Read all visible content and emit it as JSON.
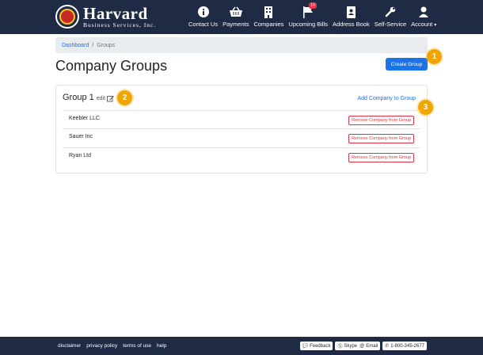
{
  "brand": {
    "name": "Harvard",
    "subtitle": "Business Services, Inc."
  },
  "nav": [
    {
      "label": "Contact Us",
      "icon": "info-icon"
    },
    {
      "label": "Payments",
      "icon": "basket-icon"
    },
    {
      "label": "Companies",
      "icon": "building-icon"
    },
    {
      "label": "Upcoming Bills",
      "icon": "flag-icon",
      "badge": "10"
    },
    {
      "label": "Address Book",
      "icon": "address-book-icon"
    },
    {
      "label": "Self-Service",
      "icon": "wrench-icon"
    },
    {
      "label": "Account",
      "icon": "user-icon"
    }
  ],
  "breadcrumb": {
    "home": "Dashboard",
    "separator": "/",
    "current": "Groups"
  },
  "page": {
    "title": "Company Groups",
    "create_button": "Create Group"
  },
  "group": {
    "title": "Group 1",
    "edit_label": "edit",
    "add_link": "Add Company to Group",
    "companies": [
      {
        "name": "Keebler LLC",
        "action": "Remove Company from Group"
      },
      {
        "name": "Sauer Inc",
        "action": "Remove Company from Group"
      },
      {
        "name": "Ryan Ltd",
        "action": "Remove Company from Group"
      }
    ]
  },
  "callouts": [
    "1",
    "2",
    "3"
  ],
  "footer": {
    "links": [
      "disclaimer",
      "privacy policy",
      "terms of use",
      "help"
    ],
    "feedback": "Feedback",
    "skype": "Skype",
    "email": "Email",
    "phone": "1-800-345-2677"
  },
  "colors": {
    "navy": "#1f2a44",
    "primary": "#1a73e8",
    "danger": "#dc3545",
    "callout": "#f0a500"
  }
}
